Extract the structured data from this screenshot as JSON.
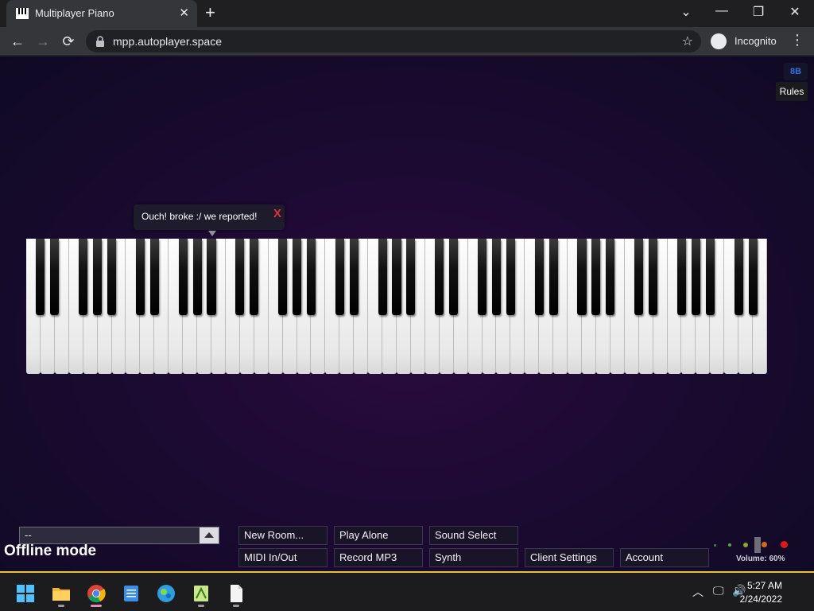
{
  "browser": {
    "tab_title": "Multiplayer Piano",
    "tab_close": "✕",
    "new_tab": "+",
    "url": "mpp.autoplayer.space",
    "incognito_label": "Incognito"
  },
  "page": {
    "rules_label": "Rules",
    "toast_message": "Ouch! broke :/ we reported!",
    "toast_close": "X",
    "room_select_value": "--",
    "status_text": "Offline mode",
    "buttons_top": [
      "New Room...",
      "Play Alone",
      "Sound Select"
    ],
    "buttons_bottom": [
      "MIDI In/Out",
      "Record MP3",
      "Synth",
      "Client Settings",
      "Account"
    ],
    "volume_label": "Volume: 60%",
    "volume_fraction": 0.6
  },
  "piano": {
    "white_key_count": 52,
    "octave_pattern": [
      "black",
      "black",
      "none",
      "black",
      "black",
      "black",
      "none"
    ]
  },
  "taskbar": {
    "time": "5:27 AM",
    "date": "2/24/2022"
  },
  "colors": {
    "accent": "#e8c23a",
    "toast_close": "#e03434"
  }
}
